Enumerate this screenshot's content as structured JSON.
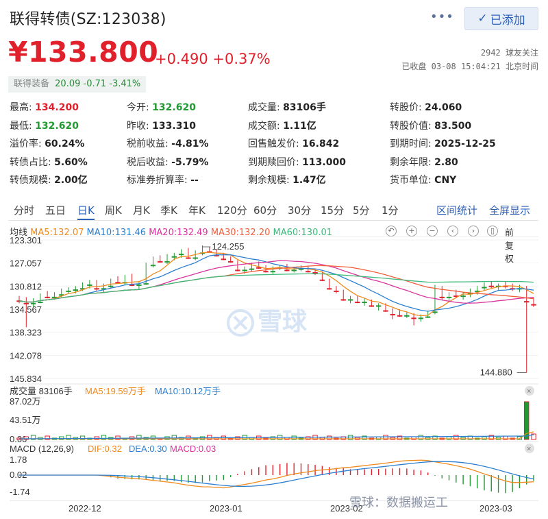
{
  "header": {
    "title": "联得转债(SZ:123038)",
    "more_icon": "more-dots-icon",
    "follow_label": "已添加",
    "follow_icon": "check-icon"
  },
  "quote": {
    "price": "¥133.800",
    "change": "+0.490",
    "change_pct": "+0.37%",
    "followers": "2942 球友关注",
    "status": "已收盘 03-08 15:04:21 北京时间",
    "colors": {
      "up": "#e0202a",
      "down": "#229933"
    }
  },
  "stock": {
    "name": "联得装备",
    "price": "20.09",
    "change": "-0.71",
    "change_pct": "-3.41%"
  },
  "stats": [
    [
      {
        "label": "最高:",
        "value": "134.200",
        "tone": "red"
      },
      {
        "label": "今开:",
        "value": "132.620",
        "tone": "green"
      },
      {
        "label": "成交量:",
        "value": "83106手",
        "tone": ""
      },
      {
        "label": "转股价:",
        "value": "24.060",
        "tone": ""
      }
    ],
    [
      {
        "label": "最低:",
        "value": "132.620",
        "tone": "green"
      },
      {
        "label": "昨收:",
        "value": "133.310",
        "tone": ""
      },
      {
        "label": "成交额:",
        "value": "1.11亿",
        "tone": ""
      },
      {
        "label": "转股价值:",
        "value": "83.500",
        "tone": ""
      }
    ],
    [
      {
        "label": "溢价率:",
        "value": "60.24%",
        "tone": ""
      },
      {
        "label": "税前收益:",
        "value": "-4.81%",
        "tone": ""
      },
      {
        "label": "回售触发价:",
        "value": "16.842",
        "tone": ""
      },
      {
        "label": "到期时间:",
        "value": "2025-12-25",
        "tone": ""
      }
    ],
    [
      {
        "label": "转债占比:",
        "value": "5.60%",
        "tone": ""
      },
      {
        "label": "税后收益:",
        "value": "-5.79%",
        "tone": ""
      },
      {
        "label": "到期赎回价:",
        "value": "113.000",
        "tone": ""
      },
      {
        "label": "剩余年限:",
        "value": "2.80",
        "tone": ""
      }
    ],
    [
      {
        "label": "转债规模:",
        "value": "2.00亿",
        "tone": ""
      },
      {
        "label": "标准券折算率:",
        "value": "--",
        "tone": ""
      },
      {
        "label": "剩余规模:",
        "value": "1.47亿",
        "tone": ""
      },
      {
        "label": "货币单位:",
        "value": "CNY",
        "tone": ""
      }
    ]
  ],
  "tabs": [
    "分时",
    "五日",
    "日K",
    "周K",
    "月K",
    "季K",
    "年K",
    "120分",
    "60分",
    "30分",
    "15分",
    "5分",
    "1分"
  ],
  "active_tab": "日K",
  "tab_links": [
    "区间统计",
    "全屏显示"
  ],
  "chart_controls": {
    "avg_label": "均线",
    "adjust_label": "前复权",
    "icons": [
      "undo-icon",
      "zoom-in-icon",
      "zoom-out-icon",
      "left-icon",
      "right-icon",
      "candle-icon"
    ]
  },
  "chart_data": {
    "type": "candlestick",
    "price_axis": {
      "ticks": [
        "145.834",
        "142.078",
        "138.323",
        "134.567",
        "130.812",
        "127.057",
        "123.301"
      ],
      "ylim": [
        123.301,
        145.834
      ]
    },
    "ma_legend": [
      {
        "name": "MA5",
        "value": "132.07",
        "color": "#f08a1c"
      },
      {
        "name": "MA10",
        "value": "131.46",
        "color": "#2c7fd0"
      },
      {
        "name": "MA20",
        "value": "132.49",
        "color": "#d9339c"
      },
      {
        "name": "MA30",
        "value": "132.20",
        "color": "#f25c3a"
      },
      {
        "name": "MA60",
        "value": "130.01",
        "color": "#3dba7a"
      }
    ],
    "annotations": {
      "high": "144.880",
      "low": "124.255"
    },
    "candles": [
      [
        133.0,
        133.6,
        132.4,
        133.2
      ],
      [
        133.2,
        137.5,
        132.6,
        133.6
      ],
      [
        133.6,
        134.2,
        132.8,
        133.4
      ],
      [
        133.4,
        133.6,
        132.0,
        132.4
      ],
      [
        132.4,
        132.8,
        131.6,
        132.6
      ],
      [
        132.6,
        133.0,
        131.8,
        132.2
      ],
      [
        132.2,
        132.6,
        131.2,
        131.6
      ],
      [
        131.6,
        132.0,
        131.0,
        131.4
      ],
      [
        131.4,
        132.0,
        130.8,
        131.2
      ],
      [
        131.2,
        131.6,
        130.2,
        130.6
      ],
      [
        130.6,
        131.2,
        129.8,
        130.0
      ],
      [
        130.0,
        131.6,
        129.8,
        131.2
      ],
      [
        131.2,
        131.8,
        130.4,
        130.8
      ],
      [
        130.8,
        131.2,
        129.6,
        129.8
      ],
      [
        129.8,
        130.4,
        129.2,
        130.2
      ],
      [
        130.2,
        130.6,
        129.0,
        129.4
      ],
      [
        129.4,
        130.8,
        128.8,
        130.6
      ],
      [
        130.6,
        131.4,
        130.2,
        130.4
      ],
      [
        130.4,
        130.6,
        127.0,
        127.4
      ],
      [
        127.4,
        127.8,
        126.0,
        126.4
      ],
      [
        126.4,
        127.0,
        125.8,
        126.8
      ],
      [
        126.8,
        127.2,
        125.6,
        126.0
      ],
      [
        126.0,
        126.6,
        125.4,
        125.6
      ],
      [
        125.6,
        126.2,
        124.8,
        125.2
      ],
      [
        125.2,
        126.4,
        124.6,
        126.2
      ],
      [
        126.2,
        126.6,
        125.0,
        125.4
      ],
      [
        125.4,
        125.8,
        124.2,
        124.6
      ],
      [
        124.6,
        125.4,
        124.4,
        125.2
      ],
      [
        125.2,
        126.0,
        124.8,
        125.8
      ],
      [
        125.8,
        126.6,
        125.4,
        126.4
      ],
      [
        126.4,
        127.0,
        126.0,
        126.8
      ],
      [
        126.8,
        128.4,
        126.6,
        128.2
      ],
      [
        128.2,
        128.8,
        127.6,
        128.0
      ],
      [
        128.0,
        128.4,
        127.0,
        127.4
      ],
      [
        127.4,
        128.0,
        126.8,
        127.8
      ],
      [
        127.8,
        128.6,
        127.4,
        128.4
      ],
      [
        128.4,
        128.8,
        127.6,
        127.8
      ],
      [
        127.8,
        128.2,
        127.4,
        127.6
      ],
      [
        127.6,
        128.4,
        127.2,
        128.2
      ],
      [
        128.2,
        128.6,
        127.8,
        128.0
      ],
      [
        128.0,
        128.4,
        127.4,
        127.8
      ],
      [
        127.8,
        128.6,
        127.6,
        128.4
      ],
      [
        128.4,
        129.0,
        128.0,
        128.6
      ],
      [
        128.6,
        130.0,
        128.4,
        129.8
      ],
      [
        129.8,
        131.4,
        129.6,
        131.2
      ],
      [
        131.2,
        132.0,
        130.8,
        131.6
      ],
      [
        131.6,
        133.2,
        131.4,
        133.0
      ],
      [
        133.0,
        133.6,
        132.4,
        132.6
      ],
      [
        132.6,
        133.6,
        132.4,
        133.4
      ],
      [
        133.4,
        134.0,
        132.8,
        133.2
      ],
      [
        133.2,
        134.2,
        133.0,
        134.0
      ],
      [
        134.0,
        134.8,
        133.6,
        133.8
      ],
      [
        133.8,
        135.0,
        133.6,
        134.8
      ],
      [
        134.8,
        136.2,
        134.4,
        135.4
      ],
      [
        135.4,
        135.8,
        134.6,
        135.6
      ],
      [
        135.6,
        136.0,
        135.0,
        135.4
      ],
      [
        135.4,
        137.2,
        135.2,
        136.0
      ],
      [
        136.0,
        136.6,
        135.4,
        135.8
      ],
      [
        135.8,
        136.0,
        134.8,
        135.0
      ],
      [
        135.0,
        135.4,
        130.6,
        131.2
      ],
      [
        131.2,
        133.0,
        130.8,
        132.6
      ],
      [
        132.6,
        133.4,
        131.8,
        132.2
      ],
      [
        132.2,
        132.8,
        131.4,
        132.4
      ],
      [
        132.4,
        133.0,
        131.8,
        132.0
      ],
      [
        132.0,
        132.6,
        131.2,
        131.6
      ],
      [
        131.6,
        132.2,
        130.8,
        131.0
      ],
      [
        131.0,
        131.6,
        130.2,
        130.6
      ],
      [
        130.6,
        131.2,
        130.0,
        130.8
      ],
      [
        130.8,
        131.4,
        130.4,
        130.6
      ],
      [
        130.6,
        131.2,
        130.0,
        130.8
      ],
      [
        130.8,
        131.6,
        130.4,
        131.2
      ],
      [
        131.2,
        131.8,
        130.6,
        131.0
      ],
      [
        131.0,
        144.88,
        130.8,
        133.3
      ],
      [
        132.62,
        134.2,
        132.62,
        133.8
      ]
    ],
    "volume": {
      "label": "成交量 83106手",
      "ma5": "MA5:19.59万手",
      "ma10": "MA10:10.12万手",
      "ticks": [
        "87.02万",
        "43.51万",
        "0.00"
      ]
    },
    "macd": {
      "label": "MACD (12,26,9)",
      "dif": "DIF:0.32",
      "dea": "DEA:0.30",
      "macd": "MACD:0.03",
      "ticks": [
        "1.78",
        "0.02",
        "-1.74"
      ]
    },
    "x_labels": [
      "2022-12",
      "2023-01",
      "2023-02",
      "2023-03"
    ]
  },
  "watermark": {
    "logo_text": "雪球",
    "footer": "雪球：数据搬运工"
  }
}
